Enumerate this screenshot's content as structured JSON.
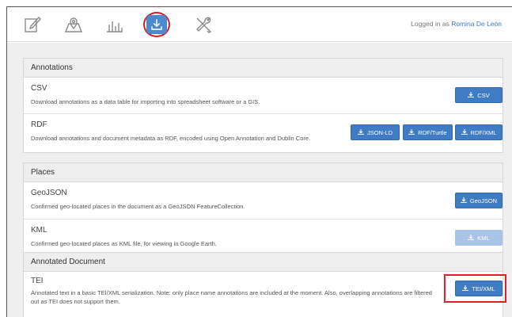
{
  "header": {
    "nav_icons": [
      "edit-icon",
      "map-icon",
      "stats-icon",
      "download-icon",
      "tools-icon"
    ],
    "login_prefix": "Logged in as",
    "user_name": "Romina De León"
  },
  "panels": {
    "annotations": {
      "title": "Annotations",
      "csv": {
        "title": "CSV",
        "desc": "Download annotations as a data table for importing into spreadsheet software or a GIS.",
        "buttons": {
          "csv": "CSV"
        }
      },
      "rdf": {
        "title": "RDF",
        "desc": "Download annotations and document metadata as RDF, encoded using Open Annotation and Dublin Core.",
        "buttons": {
          "jsonld": "JSON-LD",
          "turtle": "RDF/Turtle",
          "xml": "RDF/XML"
        }
      }
    },
    "places": {
      "title": "Places",
      "geojson": {
        "title": "GeoJSON",
        "desc": "Confirmed geo-located places in the document as a GeoJSON FeatureCollection.",
        "buttons": {
          "geojson": "GeoJSON"
        }
      },
      "kml": {
        "title": "KML",
        "desc": "Confirmed geo-located places as KML file, for viewing in Google Earth.",
        "buttons": {
          "kml": "KML"
        }
      }
    },
    "document": {
      "title": "Annotated Document",
      "tei": {
        "title": "TEI",
        "desc_line1": "Annotated text in a basic TEI/XML serialization. Note: only place name annotations are included at the moment. Also, overlapping annotations are filtered",
        "desc_line2": "out as TEI does not support them.",
        "buttons": {
          "tei": "TEI/XML"
        }
      }
    }
  },
  "colors": {
    "primary": "#3f7cc4",
    "disabled": "#a7c4e6",
    "highlight": "#e01f26",
    "background": "#efefef"
  }
}
